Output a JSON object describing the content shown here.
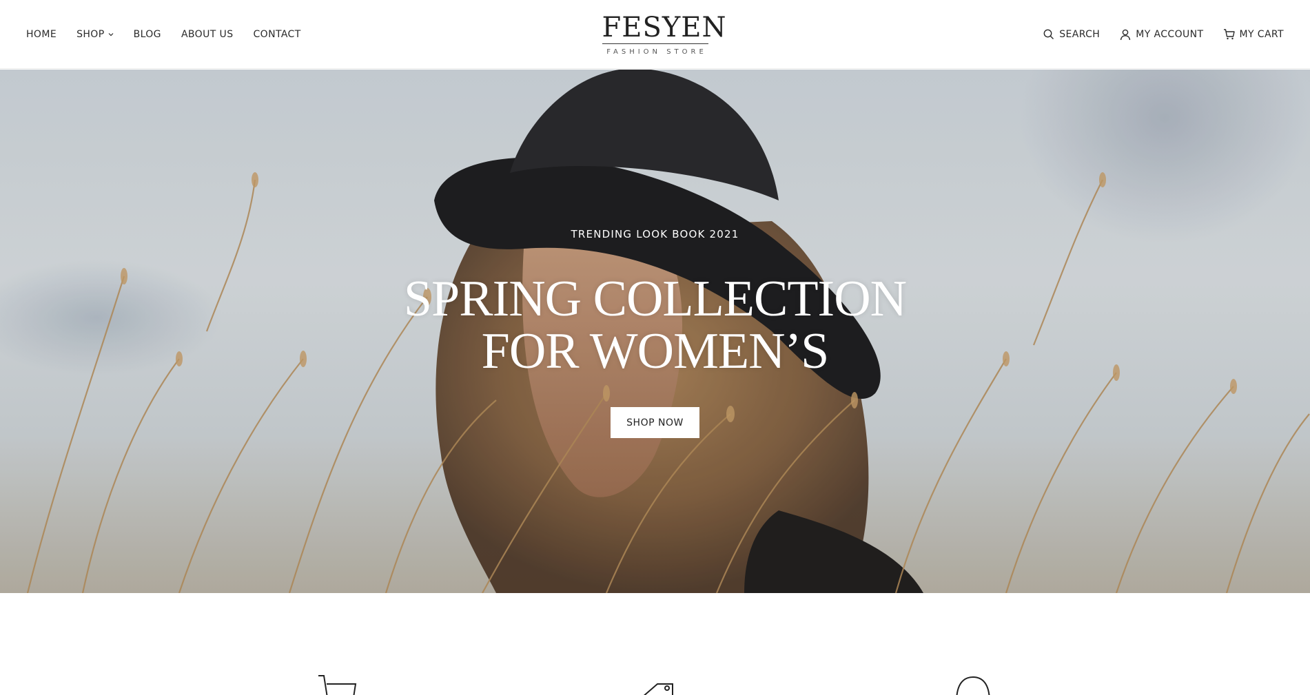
{
  "header": {
    "nav_left": [
      {
        "label": "HOME"
      },
      {
        "label": "SHOP",
        "has_dropdown": true
      },
      {
        "label": "BLOG"
      },
      {
        "label": "ABOUT US"
      },
      {
        "label": "CONTACT"
      }
    ],
    "logo": {
      "main": "FESYEN",
      "sub": "FASHION STORE"
    },
    "nav_right": {
      "search": {
        "label": "SEARCH",
        "icon": "search-icon"
      },
      "account": {
        "label": "MY ACCOUNT",
        "icon": "user-icon"
      },
      "cart": {
        "label": "MY CART",
        "icon": "cart-icon"
      }
    }
  },
  "hero": {
    "eyebrow": "TRENDING LOOK BOOK 2021",
    "title_line1": "SPRING COLLECTION",
    "title_line2": "FOR WOMEN’S",
    "cta_label": "SHOP NOW"
  },
  "features": {
    "icons": [
      "cart-icon",
      "tag-icon",
      "support-icon"
    ]
  },
  "colors": {
    "text": "#2a2a2a",
    "hero_text": "#ffffff",
    "button_bg": "#ffffff"
  }
}
